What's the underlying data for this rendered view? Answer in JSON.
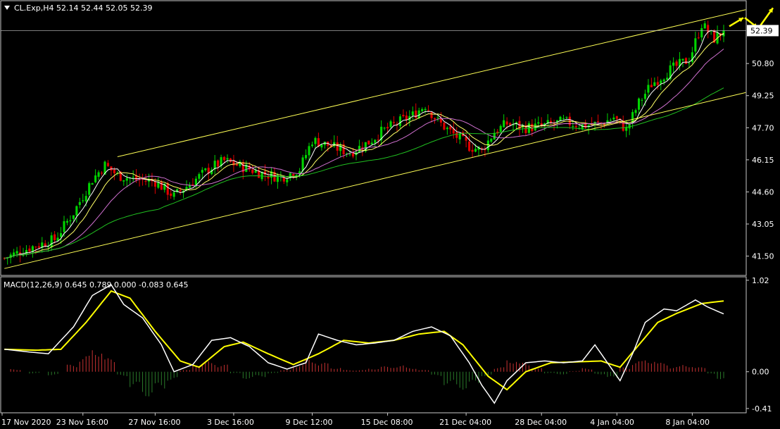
{
  "header": {
    "symbol_line": "CL.Exp,H4  52.14 52.44 52.05 52.39",
    "menu_icon": "triangle-down-icon"
  },
  "macd_header": {
    "text": "MACD(12,26,9) 0.645 0.789 0.000 -0.083 0.645"
  },
  "colors": {
    "background": "#000000",
    "grid_border": "#c8c8c8",
    "bull_candle": "#00d400",
    "bear_candle": "#e00000",
    "ma_fast": "#ffffff",
    "ma_mid": "#ffff66",
    "ma_slow_violet": "#d070d0",
    "ma_slow_green": "#20c020",
    "channel": "#ffff55",
    "macd_line": "#ffffff",
    "signal_line": "#ffff00",
    "hist_pos": "#c83232",
    "hist_neg": "#2a7a2a",
    "arrows": "#ffff00"
  },
  "chart_data": [
    {
      "type": "candlestick",
      "ylim": [
        40.6,
        53.8
      ],
      "y_ticks": [
        "52.39",
        "50.80",
        "49.25",
        "47.70",
        "46.15",
        "44.60",
        "43.05",
        "41.50"
      ],
      "current_price": "52.39",
      "x_ticks": [
        "17 Nov 2020",
        "23 Nov 16:00",
        "27 Nov 16:00",
        "3 Dec 16:00",
        "9 Dec 12:00",
        "15 Dec 08:00",
        "21 Dec 04:00",
        "28 Dec 04:00",
        "4 Jan 04:00",
        "8 Jan 04:00"
      ],
      "close_path": [
        [
          0,
          41.4
        ],
        [
          8,
          41.9
        ],
        [
          16,
          42.3
        ],
        [
          22,
          43.6
        ],
        [
          28,
          45.2
        ],
        [
          32,
          45.9
        ],
        [
          36,
          45.4
        ],
        [
          42,
          45.2
        ],
        [
          48,
          45.1
        ],
        [
          54,
          44.4
        ],
        [
          60,
          45.1
        ],
        [
          66,
          45.8
        ],
        [
          70,
          46.1
        ],
        [
          76,
          45.8
        ],
        [
          82,
          45.5
        ],
        [
          88,
          45.3
        ],
        [
          94,
          45.7
        ],
        [
          98,
          47.1
        ],
        [
          104,
          46.8
        ],
        [
          110,
          46.5
        ],
        [
          116,
          47.0
        ],
        [
          120,
          47.5
        ],
        [
          126,
          48.0
        ],
        [
          130,
          48.3
        ],
        [
          134,
          48.8
        ],
        [
          138,
          48.0
        ],
        [
          142,
          47.5
        ],
        [
          148,
          46.8
        ],
        [
          152,
          46.6
        ],
        [
          156,
          47.5
        ],
        [
          160,
          47.9
        ],
        [
          166,
          47.7
        ],
        [
          172,
          47.8
        ],
        [
          178,
          48.0
        ],
        [
          184,
          47.8
        ],
        [
          190,
          47.9
        ],
        [
          194,
          48.2
        ],
        [
          198,
          47.6
        ],
        [
          202,
          48.9
        ],
        [
          206,
          49.8
        ],
        [
          212,
          50.5
        ],
        [
          218,
          51.0
        ],
        [
          222,
          52.7
        ],
        [
          226,
          52.0
        ],
        [
          229,
          52.39
        ]
      ],
      "trend_channel": {
        "upper": [
          [
            36,
            46.3
          ],
          [
            236,
            53.4
          ]
        ],
        "lower": [
          [
            0,
            40.9
          ],
          [
            236,
            49.4
          ]
        ]
      },
      "annotations": [
        "up-arrow",
        "down-arrow",
        "up-arrow"
      ]
    },
    {
      "type": "macd",
      "ylim": [
        -0.45,
        1.05
      ],
      "y_ticks": [
        "1.02",
        "0.00",
        "-0.41"
      ],
      "macd": [
        [
          0,
          0.25
        ],
        [
          8,
          0.22
        ],
        [
          14,
          0.2
        ],
        [
          22,
          0.5
        ],
        [
          28,
          0.85
        ],
        [
          34,
          0.97
        ],
        [
          38,
          0.75
        ],
        [
          44,
          0.6
        ],
        [
          50,
          0.3
        ],
        [
          54,
          0.0
        ],
        [
          60,
          0.08
        ],
        [
          66,
          0.35
        ],
        [
          72,
          0.38
        ],
        [
          78,
          0.28
        ],
        [
          84,
          0.1
        ],
        [
          90,
          0.03
        ],
        [
          96,
          0.1
        ],
        [
          100,
          0.42
        ],
        [
          106,
          0.35
        ],
        [
          112,
          0.3
        ],
        [
          118,
          0.32
        ],
        [
          124,
          0.35
        ],
        [
          130,
          0.45
        ],
        [
          136,
          0.5
        ],
        [
          142,
          0.4
        ],
        [
          148,
          0.1
        ],
        [
          152,
          -0.15
        ],
        [
          156,
          -0.35
        ],
        [
          160,
          -0.1
        ],
        [
          166,
          0.1
        ],
        [
          172,
          0.12
        ],
        [
          178,
          0.1
        ],
        [
          184,
          0.12
        ],
        [
          188,
          0.3
        ],
        [
          192,
          0.1
        ],
        [
          196,
          -0.1
        ],
        [
          200,
          0.2
        ],
        [
          204,
          0.55
        ],
        [
          210,
          0.7
        ],
        [
          214,
          0.68
        ],
        [
          220,
          0.8
        ],
        [
          224,
          0.72
        ],
        [
          229,
          0.645
        ]
      ],
      "signal": [
        [
          0,
          0.25
        ],
        [
          10,
          0.24
        ],
        [
          18,
          0.25
        ],
        [
          26,
          0.55
        ],
        [
          34,
          0.9
        ],
        [
          40,
          0.82
        ],
        [
          48,
          0.45
        ],
        [
          56,
          0.12
        ],
        [
          62,
          0.05
        ],
        [
          70,
          0.28
        ],
        [
          76,
          0.33
        ],
        [
          84,
          0.2
        ],
        [
          92,
          0.08
        ],
        [
          100,
          0.2
        ],
        [
          108,
          0.35
        ],
        [
          116,
          0.32
        ],
        [
          124,
          0.35
        ],
        [
          132,
          0.42
        ],
        [
          140,
          0.45
        ],
        [
          146,
          0.3
        ],
        [
          154,
          -0.05
        ],
        [
          160,
          -0.2
        ],
        [
          166,
          0.0
        ],
        [
          174,
          0.1
        ],
        [
          182,
          0.11
        ],
        [
          190,
          0.12
        ],
        [
          196,
          0.05
        ],
        [
          202,
          0.3
        ],
        [
          208,
          0.55
        ],
        [
          214,
          0.65
        ],
        [
          222,
          0.76
        ],
        [
          229,
          0.789
        ]
      ],
      "histogram": [
        [
          4,
          0.03
        ],
        [
          10,
          -0.02
        ],
        [
          16,
          -0.04
        ],
        [
          22,
          0.08
        ],
        [
          26,
          0.18
        ],
        [
          30,
          0.28
        ],
        [
          34,
          0.15
        ],
        [
          38,
          -0.05
        ],
        [
          42,
          -0.18
        ],
        [
          46,
          -0.28
        ],
        [
          50,
          -0.2
        ],
        [
          54,
          -0.1
        ],
        [
          58,
          0.02
        ],
        [
          62,
          0.1
        ],
        [
          66,
          0.12
        ],
        [
          70,
          0.08
        ],
        [
          74,
          -0.02
        ],
        [
          78,
          -0.08
        ],
        [
          82,
          -0.06
        ],
        [
          86,
          -0.02
        ],
        [
          90,
          0.02
        ],
        [
          94,
          0.08
        ],
        [
          98,
          0.15
        ],
        [
          102,
          0.1
        ],
        [
          106,
          0.05
        ],
        [
          110,
          0.02
        ],
        [
          114,
          0.02
        ],
        [
          118,
          0.04
        ],
        [
          122,
          0.06
        ],
        [
          126,
          0.07
        ],
        [
          130,
          0.05
        ],
        [
          134,
          0.02
        ],
        [
          138,
          -0.05
        ],
        [
          142,
          -0.15
        ],
        [
          146,
          -0.2
        ],
        [
          150,
          -0.15
        ],
        [
          154,
          -0.05
        ],
        [
          158,
          0.05
        ],
        [
          162,
          0.15
        ],
        [
          166,
          0.1
        ],
        [
          170,
          0.04
        ],
        [
          174,
          -0.02
        ],
        [
          178,
          -0.03
        ],
        [
          182,
          0.01
        ],
        [
          186,
          0.04
        ],
        [
          190,
          -0.03
        ],
        [
          194,
          -0.08
        ],
        [
          198,
          0.05
        ],
        [
          202,
          0.12
        ],
        [
          206,
          0.15
        ],
        [
          210,
          0.1
        ],
        [
          214,
          0.06
        ],
        [
          218,
          0.08
        ],
        [
          222,
          0.05
        ],
        [
          226,
          -0.03
        ],
        [
          229,
          -0.083
        ]
      ]
    }
  ]
}
